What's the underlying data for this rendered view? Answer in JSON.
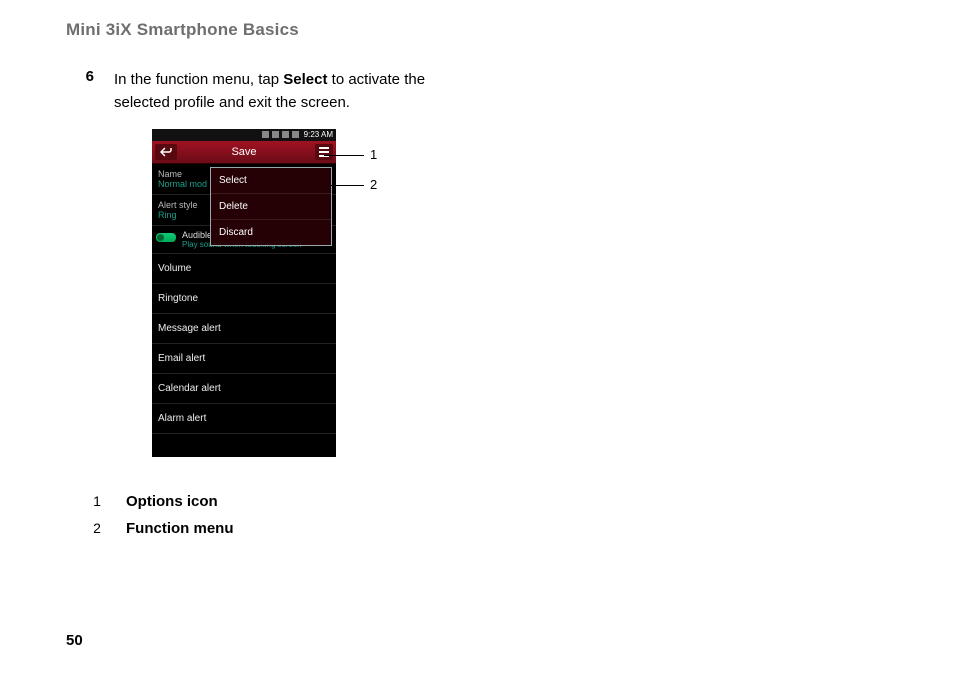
{
  "header": "Mini 3iX Smartphone Basics",
  "step": {
    "number": "6",
    "pre": "In the function menu, tap ",
    "bold": "Select",
    "post": " to activate the selected profile and exit the screen."
  },
  "phone": {
    "status_time": "9:23 AM",
    "title": "Save",
    "rows": {
      "name_label": "Name",
      "name_value": "Normal mod",
      "alert_label": "Alert style",
      "alert_value": "Ring",
      "audible_t1": "Audible",
      "audible_t2": "Play sound when touching screen"
    },
    "popup": [
      "Select",
      "Delete",
      "Discard"
    ],
    "list": [
      "Volume",
      "Ringtone",
      "Message alert",
      "Email alert",
      "Calendar alert",
      "Alarm alert"
    ]
  },
  "callouts": {
    "c1": "1",
    "c2": "2"
  },
  "legend": [
    {
      "n": "1",
      "t": "Options icon"
    },
    {
      "n": "2",
      "t": "Function menu"
    }
  ],
  "page_number": "50"
}
